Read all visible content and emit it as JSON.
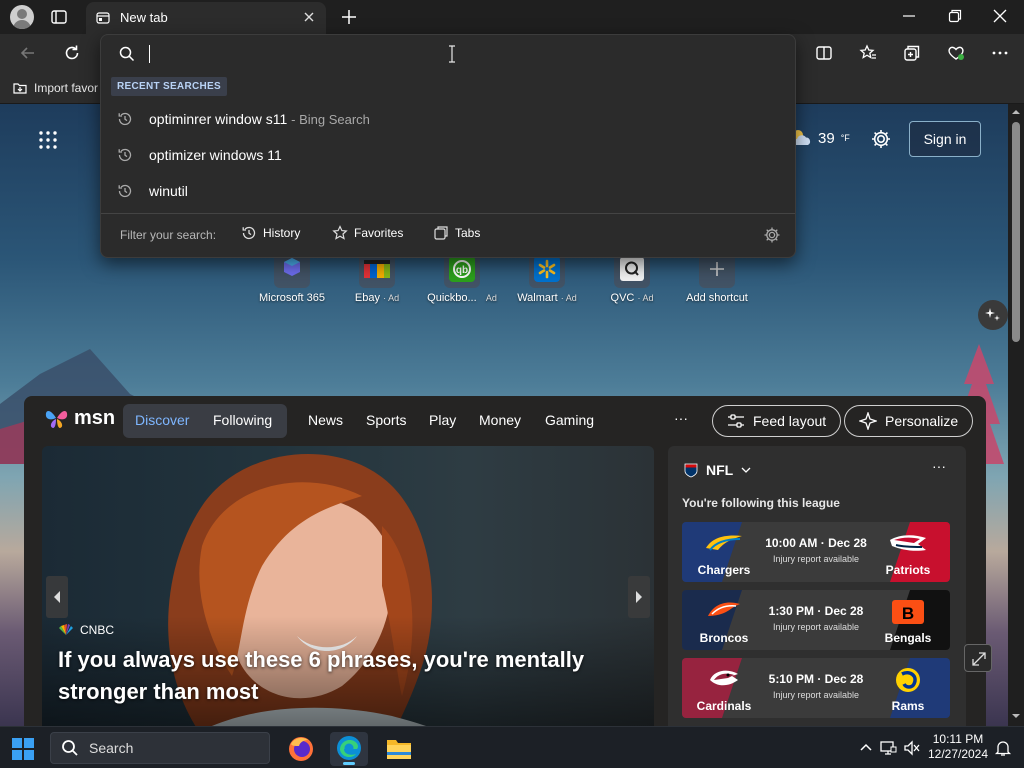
{
  "browser": {
    "tab_title": "New tab",
    "favorites_bar_item": "Import favor"
  },
  "search_dropdown": {
    "input_value": "",
    "recent_header": "RECENT SEARCHES",
    "recent": [
      {
        "text": "optiminrer window s11",
        "suffix": "- Bing Search"
      },
      {
        "text": "optimizer windows 11",
        "suffix": ""
      },
      {
        "text": "winutil",
        "suffix": ""
      }
    ],
    "filter_label": "Filter your search:",
    "filters": [
      "History",
      "Favorites",
      "Tabs"
    ]
  },
  "newtab": {
    "weather_temp": "39",
    "weather_unit": "°F",
    "sign_in": "Sign in",
    "shortcuts": [
      {
        "label": "Microsoft 365",
        "ad": ""
      },
      {
        "label": "Ebay",
        "ad": "· Ad"
      },
      {
        "label": "Quickbo...",
        "ad": "Ad"
      },
      {
        "label": "Walmart",
        "ad": "· Ad"
      },
      {
        "label": "QVC",
        "ad": "· Ad"
      },
      {
        "label": "Add shortcut",
        "ad": ""
      }
    ]
  },
  "feed": {
    "brand": "msn",
    "tabs": {
      "discover": "Discover",
      "following": "Following"
    },
    "nav": [
      "News",
      "Sports",
      "Play",
      "Money",
      "Gaming"
    ],
    "more": "···",
    "feed_layout": "Feed layout",
    "personalize": "Personalize",
    "hero": {
      "source": "CNBC",
      "title": "If you always use these 6 phrases, you're mentally stronger than most"
    },
    "nfl": {
      "league": "NFL",
      "subtitle": "You're following this league",
      "more": "···",
      "games": [
        {
          "home": "Chargers",
          "away": "Patriots",
          "time": "10:00 AM · Dec 28",
          "note": "Injury report available",
          "home_color": "#1f3a78",
          "away_color": "#c8102e"
        },
        {
          "home": "Broncos",
          "away": "Bengals",
          "time": "1:30 PM · Dec 28",
          "note": "Injury report available",
          "home_color": "#1a2b4d",
          "away_color": "#111111"
        },
        {
          "home": "Cardinals",
          "away": "Rams",
          "time": "5:10 PM · Dec 28",
          "note": "Injury report available",
          "home_color": "#97233f",
          "away_color": "#1f3a78"
        }
      ]
    }
  },
  "taskbar": {
    "search_placeholder": "Search",
    "time": "10:11 PM",
    "date": "12/27/2024"
  },
  "colors": {
    "accent": "#60cdff",
    "discover": "#7eb6ff"
  }
}
